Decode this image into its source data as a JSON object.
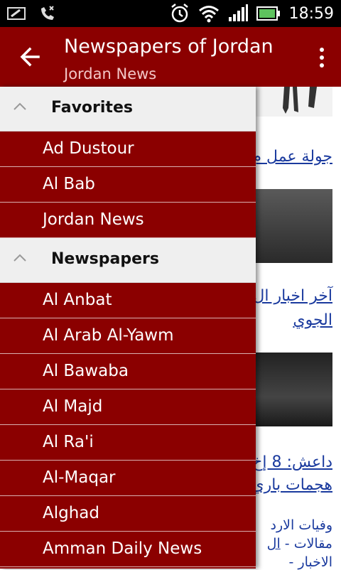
{
  "status_bar": {
    "time": "18:59",
    "icons": [
      "nfc-icon",
      "missed-call-icon",
      "alarm-icon",
      "wifi-icon",
      "signal-icon",
      "battery-icon"
    ]
  },
  "app_bar": {
    "title": "Newspapers of Jordan",
    "subtitle": "Jordan News",
    "back_icon": "arrow-left-icon",
    "menu_icon": "overflow-menu-icon",
    "color": "#8b0000"
  },
  "drawer": {
    "favorites_label": "Favorites",
    "favorites": [
      "Ad Dustour",
      "Al Bab",
      "Jordan News"
    ],
    "newspapers_label": "Newspapers",
    "newspapers": [
      "Al Anbat",
      "Al Arab Al-Yawm",
      "Al Bawaba",
      "Al Majd",
      "Al Ra'i",
      "Al-Maqar",
      "Alghad",
      "Amman Daily News"
    ]
  },
  "background": {
    "headline_1": "جولة عمل م",
    "headline_2a": "آخر اخبار ال",
    "headline_2b": "الجوي",
    "headline_3a": "داعش: 8 إخ",
    "headline_3b": "هجمات باري",
    "line_4": "وفيات الارد",
    "line_5a": "مقالات",
    "line_5b": "-",
    "line_5c": "ال",
    "line_6a": "الاخبار",
    "line_6b": "-"
  }
}
